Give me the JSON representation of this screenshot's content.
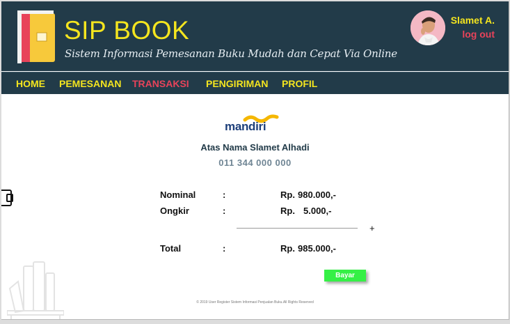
{
  "header": {
    "brand": "SIP BOOK",
    "tagline": "Sistem Informasi Pemesanan Buku Mudah dan Cepat Via Online",
    "user_name": "Slamet A.",
    "logout_label": "log out"
  },
  "nav": {
    "items": [
      {
        "label": "HOME",
        "active": false
      },
      {
        "label": "PEMESANAN",
        "active": false
      },
      {
        "label": "TRANSAKSI",
        "active": true
      },
      {
        "label": "PENGIRIMAN",
        "active": false
      },
      {
        "label": "PROFIL",
        "active": false
      }
    ]
  },
  "payment": {
    "bank_name": "mandiri",
    "account_holder": "Atas Nama Slamet Alhadi",
    "account_number": "011 344 000 000",
    "rows": [
      {
        "label": "Nominal",
        "sep": ":",
        "currency": "Rp.",
        "amount": "980.000,-"
      },
      {
        "label": "Ongkir",
        "sep": ":",
        "currency": "Rp.",
        "amount": "5.000,-"
      }
    ],
    "plus": "+",
    "total": {
      "label": "Total",
      "sep": ":",
      "currency": "Rp.",
      "amount": "985.000,-"
    },
    "pay_label": "Bayar"
  },
  "footer": {
    "text": "© 2019 User Register Sistem Informasi Penjualan Buku.All Rights Reserved"
  },
  "colors": {
    "header_bg": "#223b49",
    "brand_yellow": "#f4e51f",
    "active_red": "#e8435a",
    "pay_green": "#35f046",
    "bank_blue": "#1d3f7a",
    "bank_gold": "#f5b700"
  }
}
